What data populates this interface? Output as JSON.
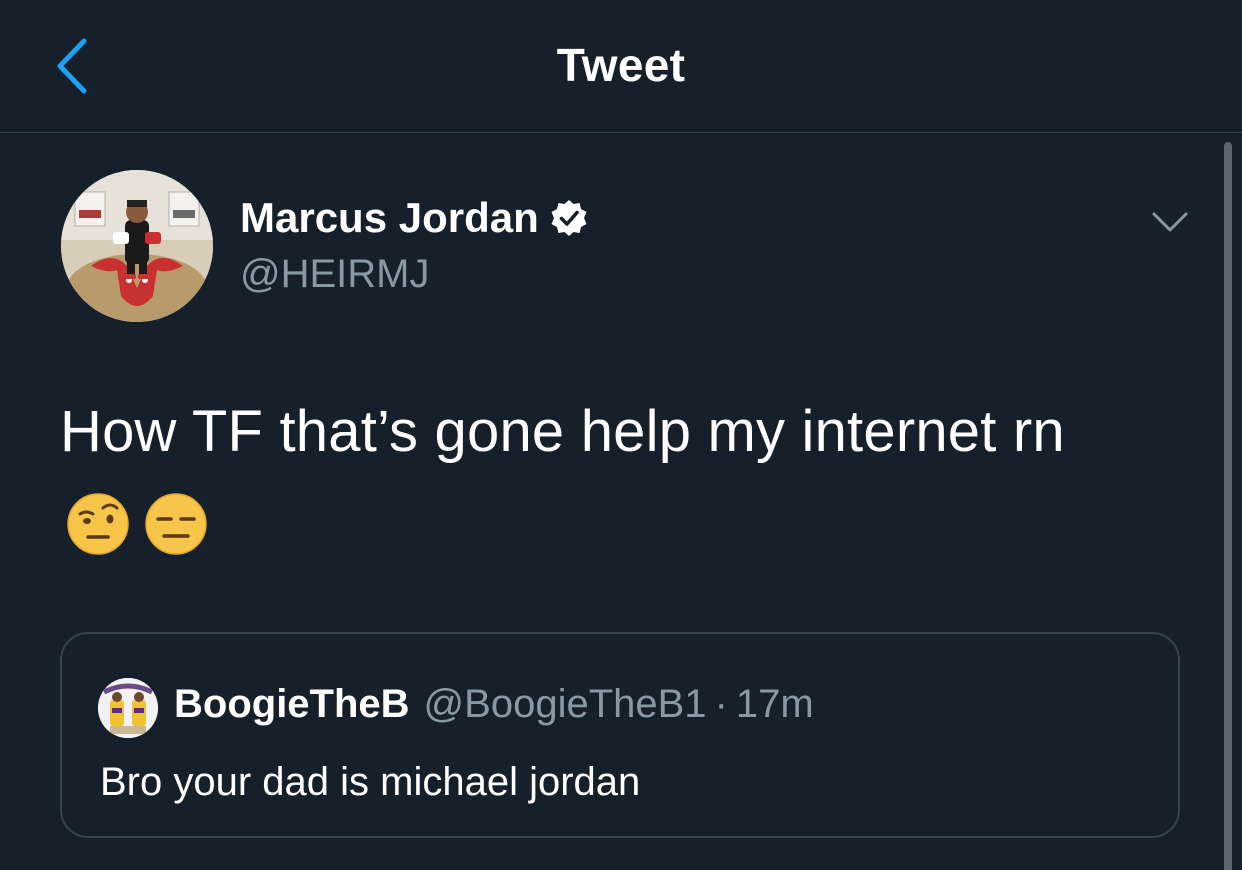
{
  "nav": {
    "title": "Tweet",
    "back_icon": "chevron-left-icon"
  },
  "tweet": {
    "author_name": "Marcus Jordan",
    "author_handle": "@HEIRMJ",
    "verified": true,
    "text": "How TF that’s gone help my internet rn",
    "emojis": [
      "face-with-raised-eyebrow",
      "expressionless-face"
    ]
  },
  "quoted_tweet": {
    "author_name": "BoogieTheB",
    "author_handle": "@BoogieTheB1",
    "separator": "·",
    "time": "17m",
    "text": "Bro your dad is michael jordan"
  },
  "colors": {
    "background": "#15202b",
    "accent": "#1da1f2",
    "secondary_text": "#8899a6",
    "border": "#38444d"
  }
}
